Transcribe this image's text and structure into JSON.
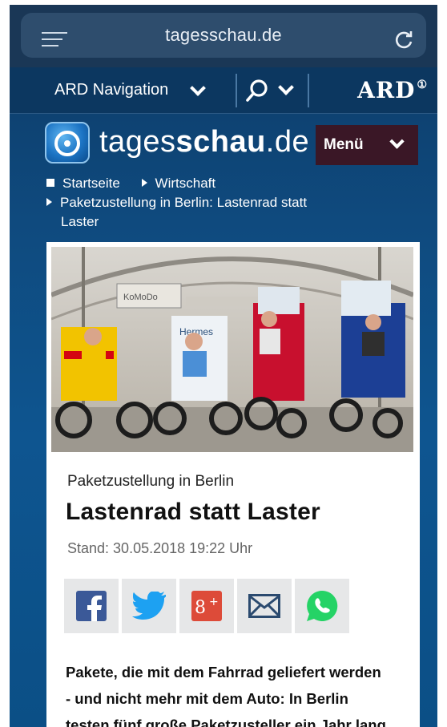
{
  "browser": {
    "url": "tagesschau.de"
  },
  "ard_bar": {
    "navigation_label": "ARD Navigation",
    "logo_text": "ARD"
  },
  "site": {
    "title_light": "tages",
    "title_bold": "schau",
    "title_suffix": ".de",
    "menu_label": "Menü"
  },
  "breadcrumb": [
    "Startseite",
    "Wirtschaft",
    "Paketzustellung in Berlin: Lastenrad statt",
    "Laster"
  ],
  "article": {
    "kicker": "Paketzustellung in Berlin",
    "headline": "Lastenrad statt Laster",
    "stand": "Stand: 30.05.2018 19:22 Uhr",
    "lead_lines": [
      "Pakete, die mit dem Fahrrad geliefert werden",
      "- und nicht mehr mit dem Auto: In Berlin",
      "testen fünf große Paketzusteller ein Jahr lang,"
    ],
    "photo_signs": [
      "KoMoDo",
      "Hermes"
    ]
  },
  "share_buttons": [
    {
      "name": "facebook-icon",
      "color": "#3b5998"
    },
    {
      "name": "twitter-icon",
      "color": "#1da1f2"
    },
    {
      "name": "google-plus-icon",
      "color": "#dd4b39"
    },
    {
      "name": "mail-icon",
      "color": "#2b4a6f"
    },
    {
      "name": "whatsapp-icon",
      "color": "#25d366"
    }
  ]
}
